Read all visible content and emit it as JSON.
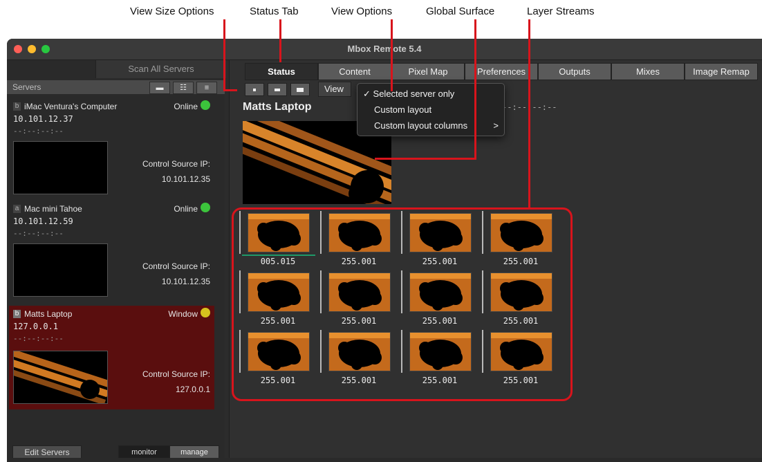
{
  "callouts": {
    "view_size": "View Size Options",
    "status_tab": "Status Tab",
    "view_options": "View Options",
    "global_surface": "Global Surface",
    "layer_streams": "Layer Streams"
  },
  "window": {
    "title": "Mbox Remote 5.4"
  },
  "sidebar": {
    "scan_button": "Scan All Servers",
    "servers_header": "Servers",
    "view_buttons": [
      "▬",
      "☷",
      "≡"
    ],
    "servers": [
      {
        "letter": "b",
        "name": "iMac Ventura's Computer",
        "status": "Online",
        "led_color": "#3cc43c",
        "ip": "10.101.12.37",
        "timecode": "--:--:--:--",
        "control_source_label": "Control Source IP:",
        "control_source_ip": "10.101.12.35"
      },
      {
        "letter": "a",
        "name": "Mac mini Tahoe",
        "status": "Online",
        "led_color": "#3cc43c",
        "ip": "10.101.12.59",
        "timecode": "--:--:--:--",
        "control_source_label": "Control Source IP:",
        "control_source_ip": "10.101.12.35"
      },
      {
        "letter": "b",
        "name": "Matts Laptop",
        "status": "Window",
        "led_color": "#d6c21e",
        "ip": "127.0.0.1",
        "timecode": "--:--:--:--",
        "control_source_label": "Control Source IP:",
        "control_source_ip": "127.0.0.1"
      }
    ],
    "edit_servers": "Edit Servers",
    "mode_monitor": "monitor",
    "mode_manage": "manage"
  },
  "tabs": [
    {
      "label": "Status",
      "active": true
    },
    {
      "label": "Content",
      "active": false
    },
    {
      "label": "Pixel Map",
      "active": false
    },
    {
      "label": "Preferences",
      "active": false
    },
    {
      "label": "Outputs",
      "active": false
    },
    {
      "label": "Mixes",
      "active": false
    },
    {
      "label": "Image Remap",
      "active": false
    }
  ],
  "toolbar": {
    "view_label": "View"
  },
  "view_menu": {
    "items": [
      {
        "label": "Selected server only",
        "checked": true
      },
      {
        "label": "Custom layout",
        "checked": false
      },
      {
        "label": "Custom layout columns",
        "submenu": true
      }
    ],
    "check_glyph": "✓",
    "submenu_glyph": ">"
  },
  "main": {
    "server_title": "Matts Laptop",
    "timecode": "--:--:--:--",
    "layers": [
      "005.015",
      "255.001",
      "255.001",
      "255.001",
      "255.001",
      "255.001",
      "255.001",
      "255.001",
      "255.001",
      "255.001",
      "255.001",
      "255.001"
    ]
  },
  "colors": {
    "accent_red": "#d8141c",
    "selected_server": "#5a0e0e",
    "progress_green": "#1f9a68"
  }
}
